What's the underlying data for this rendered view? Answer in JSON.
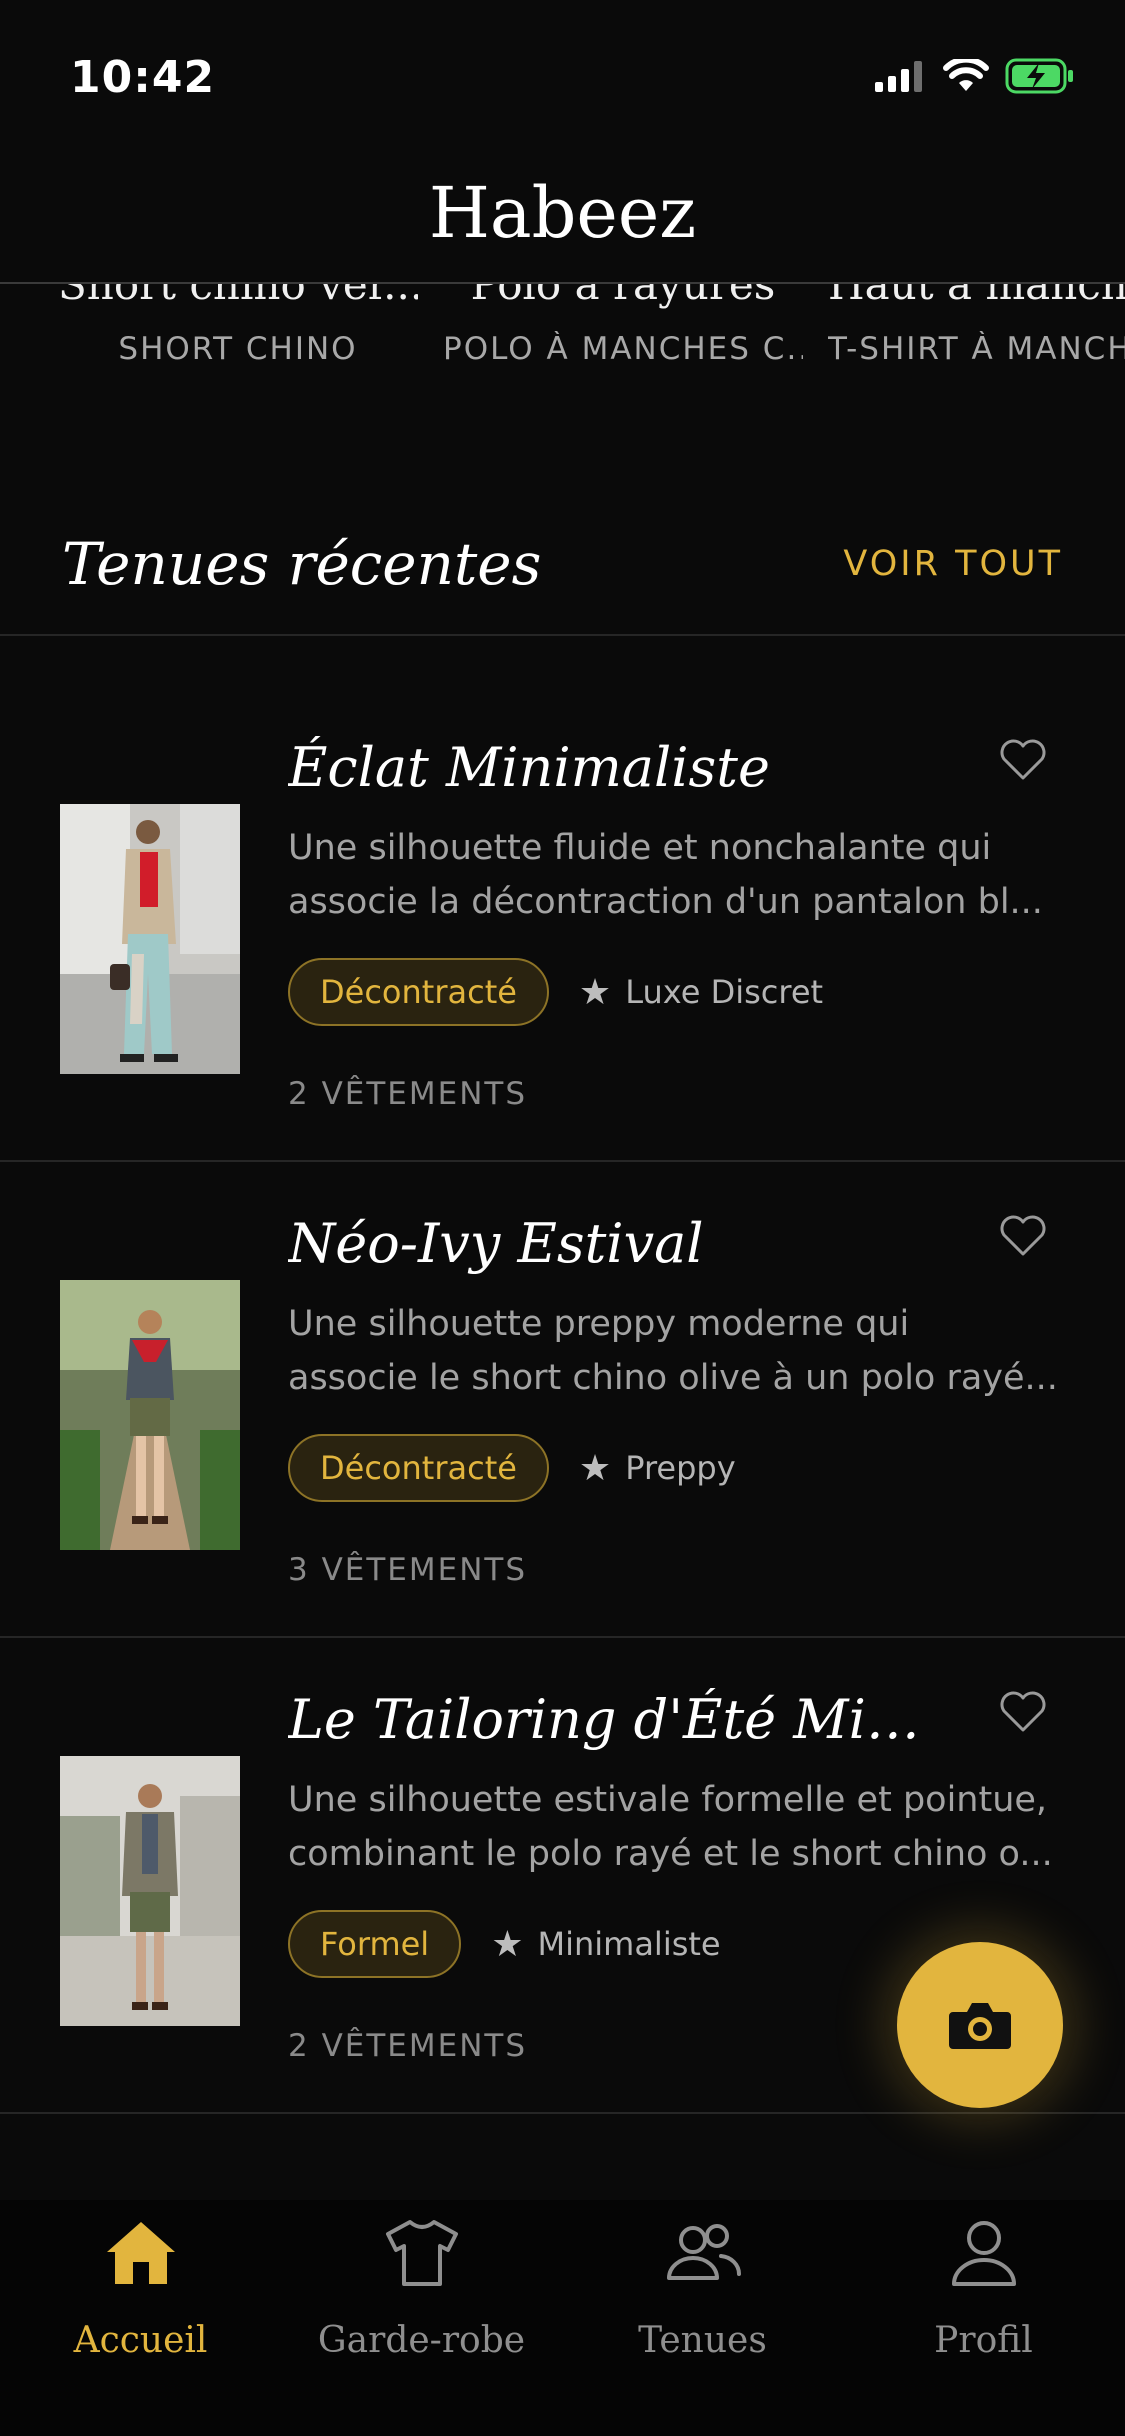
{
  "status_bar": {
    "time": "10:42"
  },
  "header": {
    "title": "Habeez"
  },
  "carousel": [
    {
      "name": "Short chino ver...",
      "type": "SHORT CHINO"
    },
    {
      "name": "Polo à rayures",
      "type": "POLO À MANCHES C..."
    },
    {
      "name": "Haut à manche",
      "type": "T-SHIRT À MANCH"
    }
  ],
  "section": {
    "title": "Tenues récentes",
    "see_all": "VOIR TOUT"
  },
  "outfits": [
    {
      "title": "Éclat Minimaliste",
      "desc_line1": "Une silhouette fluide et nonchalante qui",
      "desc_line2": "associe la décontraction d'un pantalon bl...",
      "occasion": "Décontracté",
      "style": "Luxe Discret",
      "count": "2 VÊTEMENTS"
    },
    {
      "title": "Néo-Ivy Estival",
      "desc_line1": "Une silhouette preppy moderne qui",
      "desc_line2": "associe le short chino olive à un polo rayé...",
      "occasion": "Décontracté",
      "style": "Preppy",
      "count": "3 VÊTEMENTS"
    },
    {
      "title": "Le Tailoring d'Été Minimal...",
      "desc_line1": "Une silhouette estivale formelle et pointue,",
      "desc_line2": "combinant le polo rayé et le short chino o...",
      "occasion": "Formel",
      "style": "Minimaliste",
      "count": "2 VÊTEMENTS"
    }
  ],
  "fab": {
    "icon": "camera-icon"
  },
  "tabs": [
    {
      "label": "Accueil",
      "icon": "home-icon",
      "active": true
    },
    {
      "label": "Garde-robe",
      "icon": "tshirt-icon",
      "active": false
    },
    {
      "label": "Tenues",
      "icon": "people-icon",
      "active": false
    },
    {
      "label": "Profil",
      "icon": "person-icon",
      "active": false
    }
  ],
  "colors": {
    "accent": "#e2b53e",
    "background": "#0a0a0a",
    "battery": "#4cd964"
  }
}
